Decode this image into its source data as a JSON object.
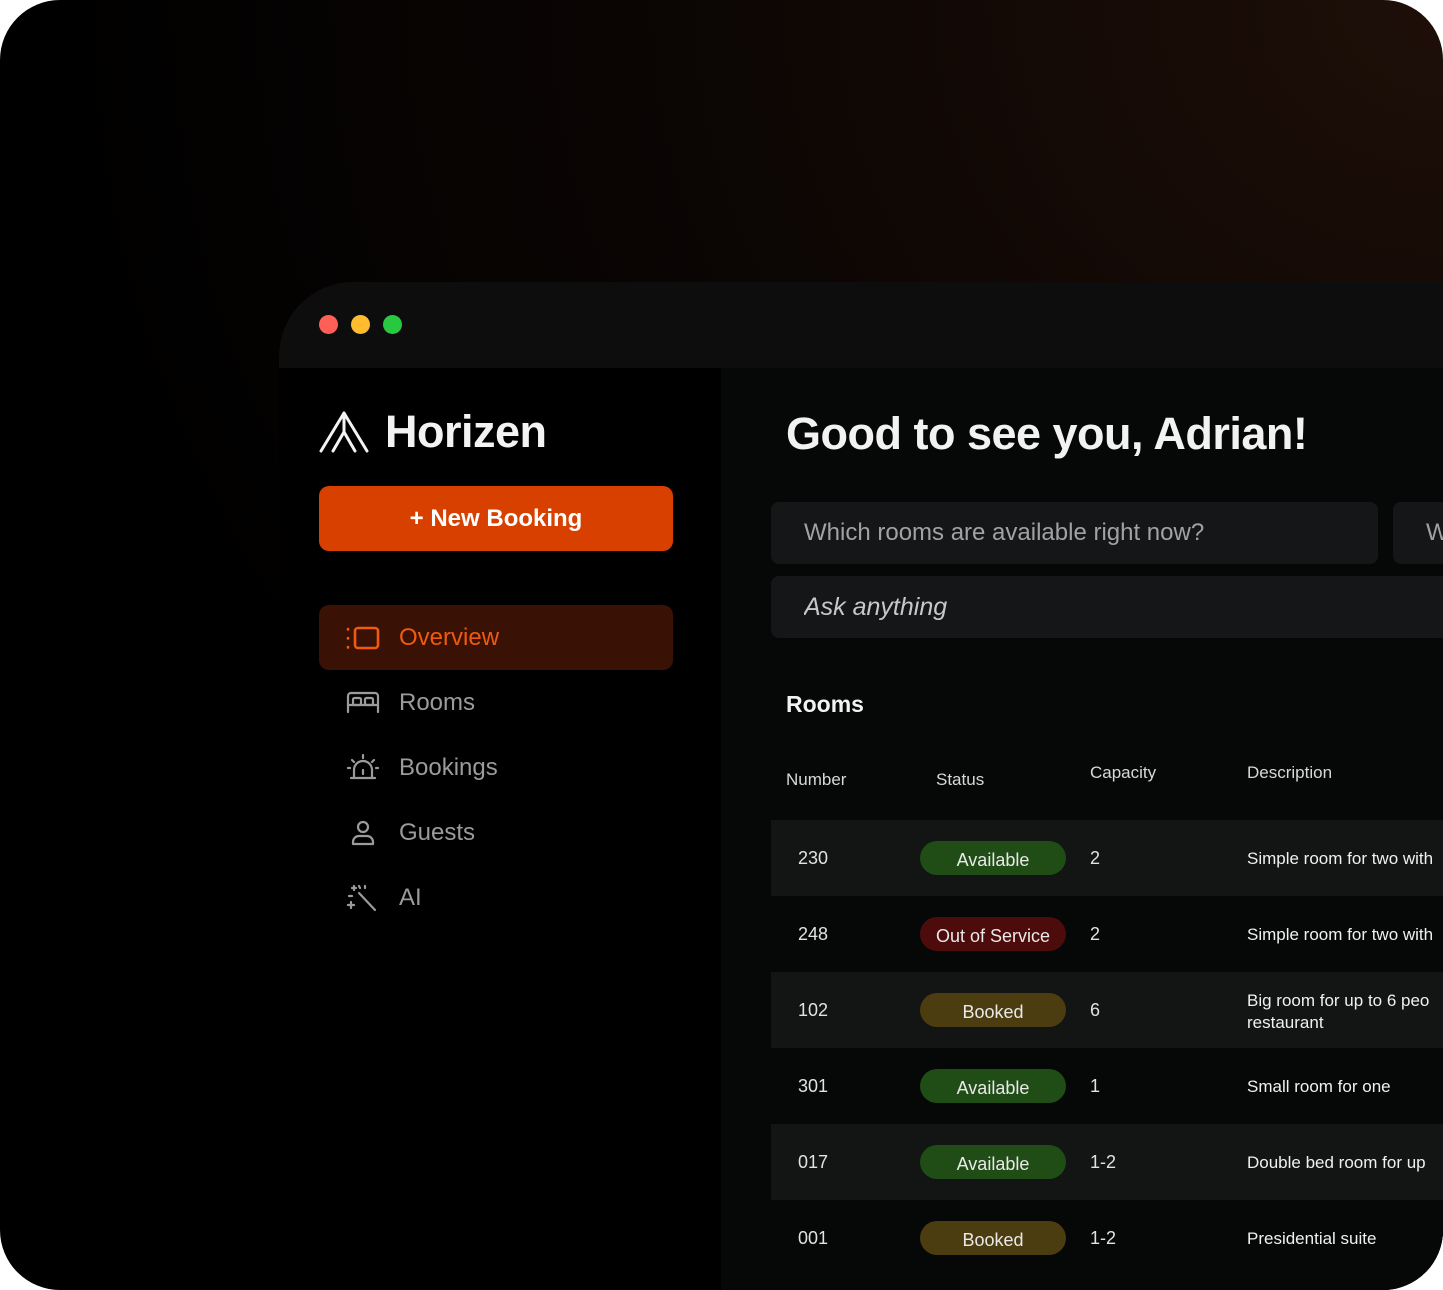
{
  "app": {
    "name": "Horizen"
  },
  "sidebar": {
    "new_booking_label": "+ New Booking",
    "items": [
      {
        "label": "Overview",
        "icon": "overview-icon",
        "active": true
      },
      {
        "label": "Rooms",
        "icon": "bed-icon",
        "active": false
      },
      {
        "label": "Bookings",
        "icon": "bell-icon",
        "active": false
      },
      {
        "label": "Guests",
        "icon": "user-icon",
        "active": false
      },
      {
        "label": "AI",
        "icon": "magic-wand-icon",
        "active": false
      }
    ]
  },
  "main": {
    "greeting": "Good to see you, Adrian!",
    "suggestions": [
      "Which rooms are available right now?",
      "W"
    ],
    "ask_placeholder": "Ask anything",
    "rooms_title": "Rooms",
    "columns": {
      "number": "Number",
      "status": "Status",
      "capacity": "Capacity",
      "description": "Description"
    },
    "rows": [
      {
        "number": "230",
        "status": "Available",
        "status_kind": "available",
        "capacity": "2",
        "description": [
          "Simple room for two with"
        ]
      },
      {
        "number": "248",
        "status": "Out of Service",
        "status_kind": "oos",
        "capacity": "2",
        "description": [
          "Simple room for two with"
        ]
      },
      {
        "number": "102",
        "status": "Booked",
        "status_kind": "booked",
        "capacity": "6",
        "description": [
          "Big room for up to 6 peo",
          "restaurant"
        ]
      },
      {
        "number": "301",
        "status": "Available",
        "status_kind": "available",
        "capacity": "1",
        "description": [
          "Small room for one"
        ]
      },
      {
        "number": "017",
        "status": "Available",
        "status_kind": "available",
        "capacity": "1-2",
        "description": [
          "Double bed room for up"
        ]
      },
      {
        "number": "001",
        "status": "Booked",
        "status_kind": "booked",
        "capacity": "1-2",
        "description": [
          "Presidential suite"
        ]
      }
    ]
  },
  "colors": {
    "accent": "#d84000",
    "active_nav_bg": "#3a1105",
    "active_nav_text": "#ee5a0f",
    "available": "#1f4d15",
    "out_of_service": "#4e0b0b",
    "booked": "#4c3d10"
  }
}
